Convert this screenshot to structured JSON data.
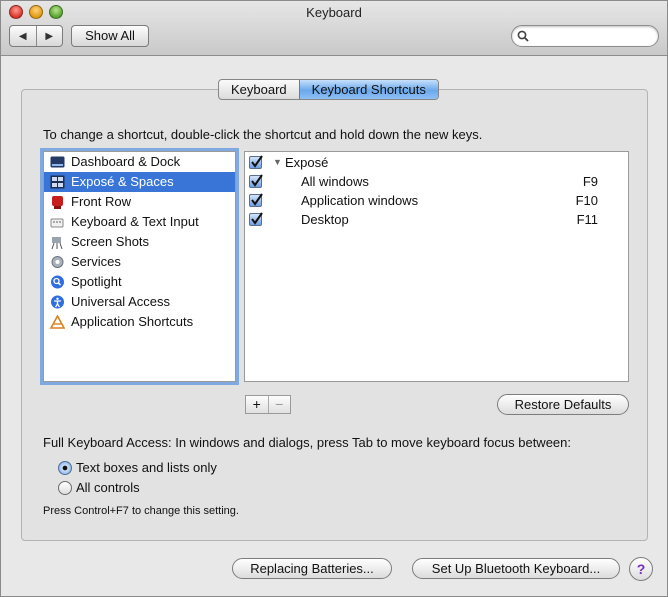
{
  "window": {
    "title": "Keyboard",
    "nav_back": "◀",
    "nav_forward": "▶",
    "show_all": "Show All",
    "search_value": ""
  },
  "tabs": [
    {
      "label": "Keyboard",
      "active": false
    },
    {
      "label": "Keyboard Shortcuts",
      "active": true
    }
  ],
  "instruction": "To change a shortcut, double-click the shortcut and hold down the new keys.",
  "categories": [
    {
      "label": "Dashboard & Dock",
      "icon": "dashboard-icon",
      "selected": false
    },
    {
      "label": "Exposé & Spaces",
      "icon": "expose-icon",
      "selected": true
    },
    {
      "label": "Front Row",
      "icon": "front-row-icon",
      "selected": false
    },
    {
      "label": "Keyboard & Text Input",
      "icon": "keyboard-icon",
      "selected": false
    },
    {
      "label": "Screen Shots",
      "icon": "camera-icon",
      "selected": false
    },
    {
      "label": "Services",
      "icon": "gear-icon",
      "selected": false
    },
    {
      "label": "Spotlight",
      "icon": "spotlight-icon",
      "selected": false
    },
    {
      "label": "Universal Access",
      "icon": "universal-access-icon",
      "selected": false
    },
    {
      "label": "Application Shortcuts",
      "icon": "app-shortcuts-icon",
      "selected": false
    }
  ],
  "shortcuts": {
    "group": {
      "label": "Exposé",
      "checked": true,
      "expanded": true
    },
    "items": [
      {
        "label": "All windows",
        "key": "F9",
        "checked": true
      },
      {
        "label": "Application windows",
        "key": "F10",
        "checked": true
      },
      {
        "label": "Desktop",
        "key": "F11",
        "checked": true
      }
    ]
  },
  "list_controls": {
    "add": "+",
    "remove": "−"
  },
  "restore_defaults": "Restore Defaults",
  "full_keyboard_access": {
    "label": "Full Keyboard Access: In windows and dialogs, press Tab to move keyboard focus between:",
    "options": [
      {
        "label": "Text boxes and lists only",
        "selected": true
      },
      {
        "label": "All controls",
        "selected": false
      }
    ],
    "note": "Press Control+F7 to change this setting."
  },
  "footer": {
    "replacing_batteries": "Replacing Batteries...",
    "bluetooth_keyboard": "Set Up Bluetooth Keyboard...",
    "help": "?"
  }
}
